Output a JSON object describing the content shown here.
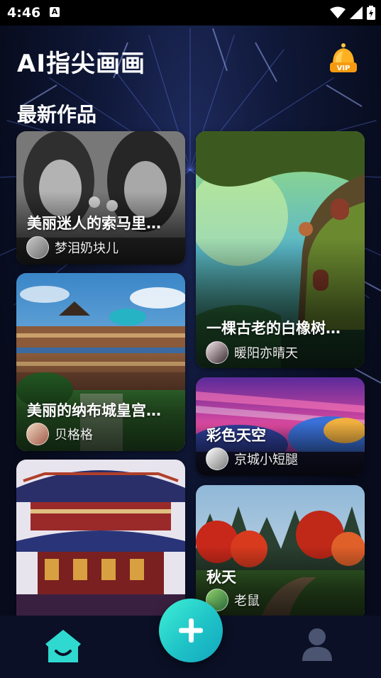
{
  "status_bar": {
    "time": "4:46",
    "notification_icon": "a-icon",
    "icons": [
      "wifi-icon",
      "signal-icon",
      "battery-icon"
    ]
  },
  "header": {
    "title": "AI指尖画画",
    "vip_icon": "vip-crown-icon",
    "vip_label": "VIP"
  },
  "section": {
    "title": "最新作品"
  },
  "artworks": [
    {
      "title": "美丽迷人的索马里…",
      "author": "梦泪奶块儿"
    },
    {
      "title": "一棵古老的白橡树…",
      "author": "暖阳亦晴天"
    },
    {
      "title": "美丽的纳布城皇宫…",
      "author": "贝格格"
    },
    {
      "title": "彩色天空",
      "author": "京城小短腿"
    },
    {
      "title": "",
      "author": ""
    },
    {
      "title": "秋天",
      "author": "老鼠"
    }
  ],
  "bottom_nav": {
    "home_icon": "home-icon",
    "create_icon": "plus-icon",
    "profile_icon": "profile-icon"
  },
  "colors": {
    "background": "#070b1c",
    "accent": "#2fd9cf",
    "nav_bg": "#0b1026",
    "vip_gold": "#f5a623"
  }
}
